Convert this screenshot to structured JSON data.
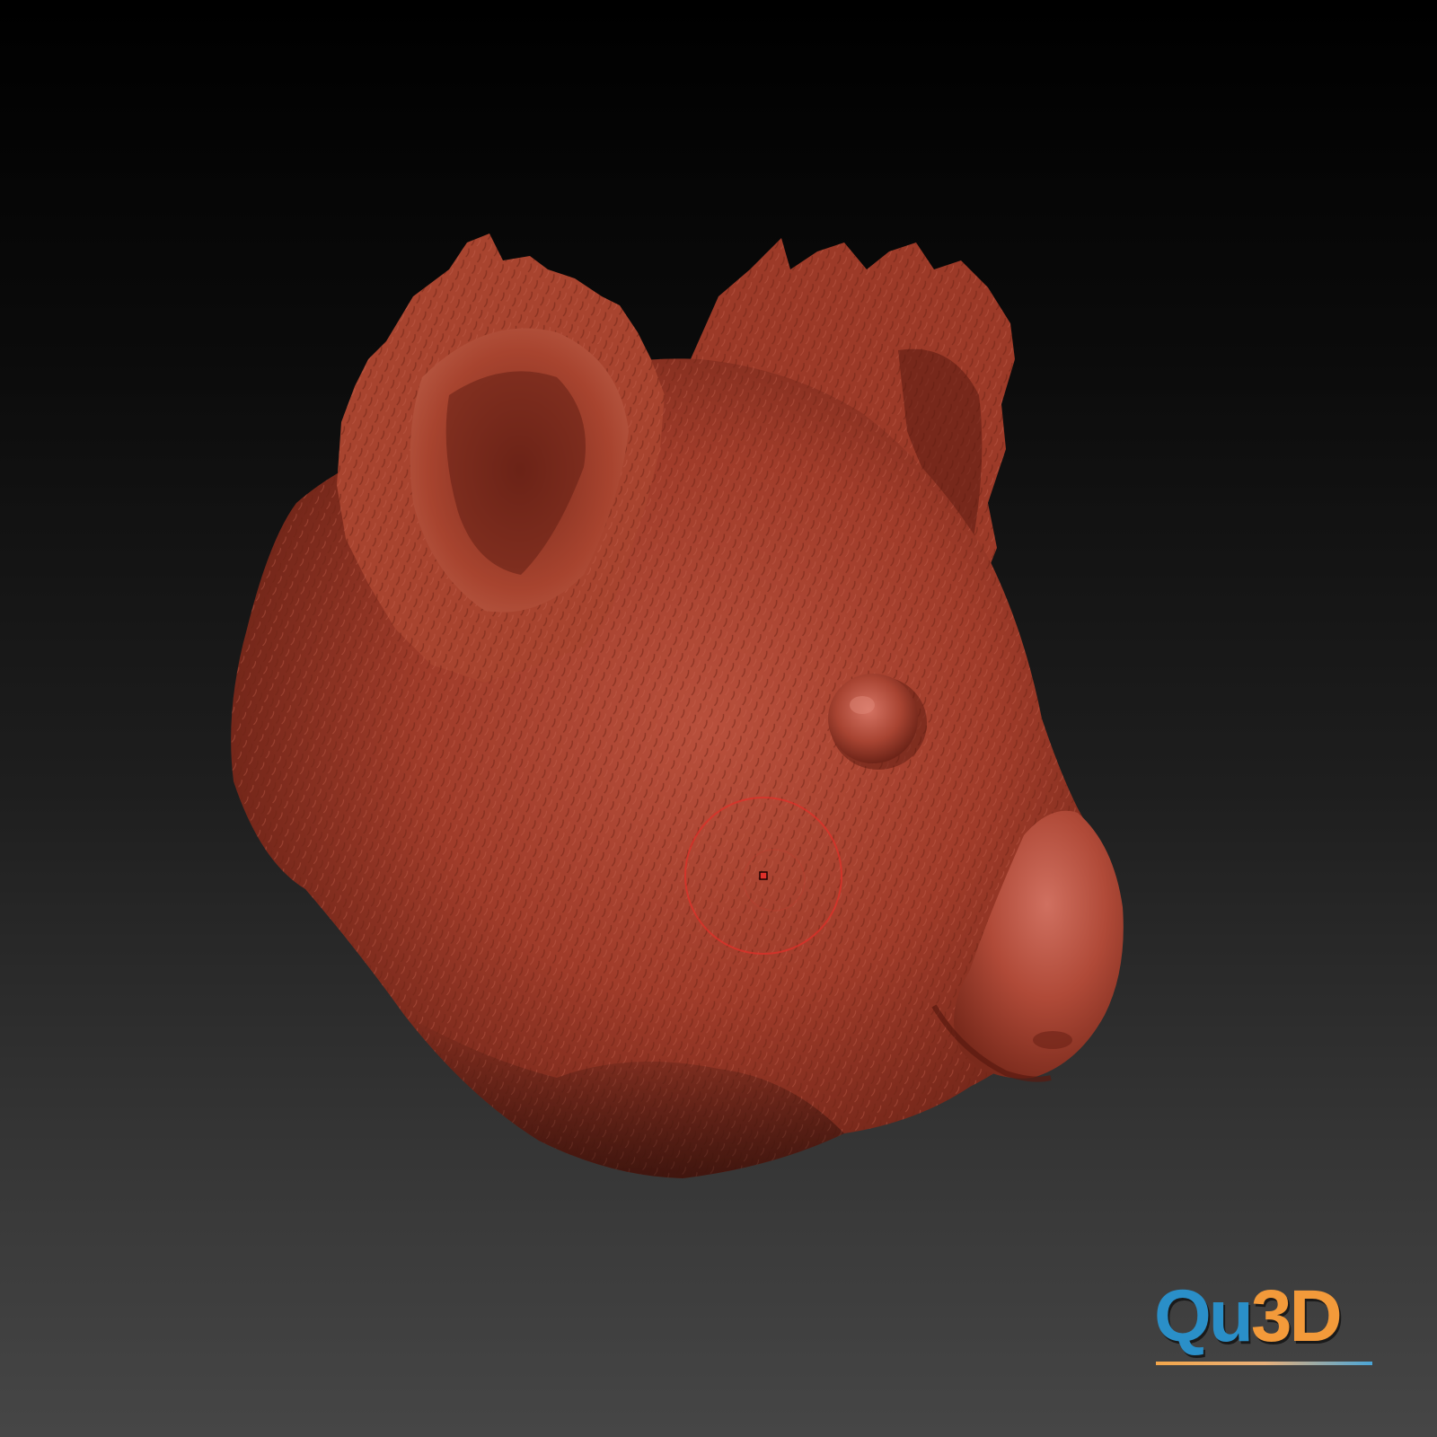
{
  "scene": {
    "subject": "koala-head-sculpt",
    "colors": {
      "background_top": "#000000",
      "background_bottom": "#464646",
      "clay": "#a8402e",
      "clay_highlight": "#c8604c",
      "clay_shadow": "#5a1a10",
      "brush_cursor": "#e0302a"
    }
  },
  "logo": {
    "part1": "Qu",
    "part2": "3D",
    "colors": {
      "qu": "#2a8fc8",
      "three_d": "#f39a3a"
    }
  }
}
